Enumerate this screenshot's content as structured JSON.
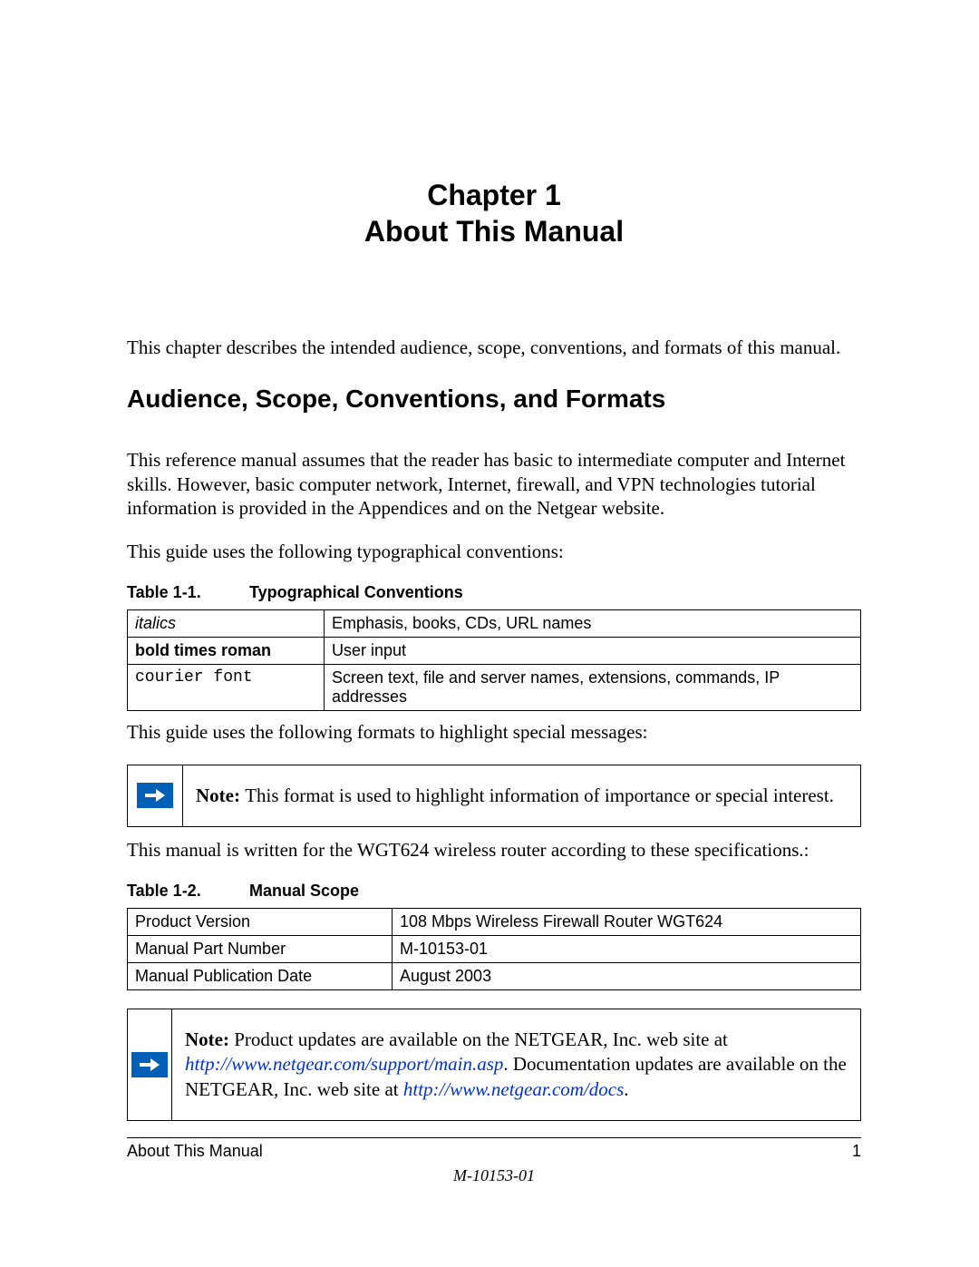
{
  "chapter": {
    "line1": "Chapter 1",
    "line2": "About This Manual"
  },
  "intro": "This chapter describes the intended audience, scope, conventions, and formats of this manual.",
  "section_heading": "Audience, Scope, Conventions, and Formats",
  "para1": "This reference manual assumes that the reader has basic to intermediate computer and Internet skills. However, basic computer network, Internet, firewall, and VPN technologies tutorial information is provided in the Appendices and on the Netgear website.",
  "para2": "This guide uses the following typographical conventions:",
  "table1": {
    "caption_label": "Table 1-1.",
    "caption_title": "Typographical Conventions",
    "rows": [
      {
        "c1": "italics",
        "c2": "Emphasis, books, CDs, URL names"
      },
      {
        "c1": "bold times roman",
        "c2": "User input"
      },
      {
        "c1": "courier font",
        "c2": "Screen text, file and server names, extensions, commands, IP addresses"
      }
    ]
  },
  "para3": "This guide uses the following formats to highlight special messages:",
  "note1": {
    "label": "Note: ",
    "text": "This format is used to highlight information of importance or special interest."
  },
  "para4": "This manual is written for the WGT624 wireless router according to these specifications.:",
  "table2": {
    "caption_label": "Table 1-2.",
    "caption_title": "Manual Scope",
    "rows": [
      {
        "c1": "Product Version",
        "c2": "108 Mbps Wireless Firewall Router WGT624"
      },
      {
        "c1": "Manual Part Number",
        "c2": "M-10153-01"
      },
      {
        "c1": "Manual Publication Date",
        "c2": "August 2003"
      }
    ]
  },
  "note2": {
    "label": "Note: ",
    "t1": "Product updates are available on the NETGEAR, Inc. web site at ",
    "link1": "http://www.netgear.com/support/main.asp",
    "t2": ". Documentation updates are available on the NETGEAR, Inc. web site at ",
    "link2": "http://www.netgear.com/docs",
    "t3": "."
  },
  "footer": {
    "left": "About This Manual",
    "right": "1",
    "docnum": "M-10153-01"
  }
}
